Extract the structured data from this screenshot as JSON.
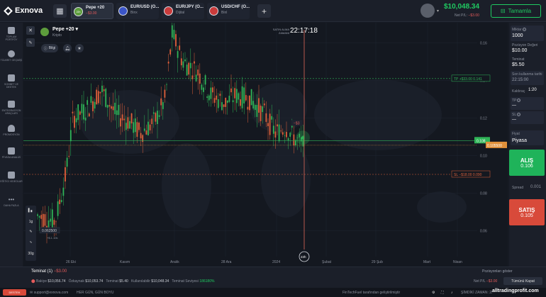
{
  "app": {
    "logo_text": "Exnova"
  },
  "tabs": [
    {
      "name": "Pepe +20",
      "sub": "−$3.00",
      "badge": "22h",
      "active": true
    },
    {
      "name": "EUR/USD (O...",
      "sub": "Binx",
      "active": false
    },
    {
      "name": "EUR/JPY (O...",
      "sub": "Dijital",
      "active": false
    },
    {
      "name": "USD/CHF (O...",
      "sub": "Binl",
      "active": false
    }
  ],
  "account": {
    "balance": "$10,048.34",
    "net_pl_label": "Net P/L",
    "net_pl_value": "−$3.00",
    "topup_label": "Tamamla"
  },
  "sidebar": {
    "items": [
      {
        "label": "TOPLAM PORTFÖY",
        "icon": "portfolio-icon"
      },
      {
        "label": "TİCARET GEÇMİŞİ",
        "icon": "history-icon"
      },
      {
        "label": "SOHBET VE DESTEK",
        "icon": "chat-icon"
      },
      {
        "label": "ENTEGRASYON ARAÇLARI",
        "icon": "tools-icon"
      },
      {
        "label": "PROMOSYON",
        "icon": "flame-icon"
      },
      {
        "label": "PİYASA ANALİZİ",
        "icon": "analysis-icon"
      },
      {
        "label": "EĞİTİCİ VİDEOLAR",
        "icon": "video-icon"
      },
      {
        "label": "DAHA FAZLA",
        "icon": "more-icon"
      }
    ]
  },
  "asset": {
    "name": "Pepe +20",
    "category": "Kripto",
    "info_label": "Bilgi"
  },
  "chart_overlay": {
    "buy_time_label": "SATIN ALMA ZAMANI",
    "buy_time": "22:17:18",
    "expiry_badge": "22h",
    "trade_marker": "−$3"
  },
  "chart_data": {
    "type": "candlestick",
    "y_ticks": [
      "0.16",
      "0.14",
      "0.12",
      "0.10",
      "0.08",
      "0.06"
    ],
    "x_ticks": [
      "26 Eki",
      "Kasım",
      "Aralık",
      "28 Ara",
      "2024",
      "Şubat",
      "29 Şub",
      "Mart",
      "Nisan"
    ],
    "high_label": "0.174500",
    "low_label": "0.062500",
    "current_price": "0.108",
    "open_price": "0.105500",
    "tp_line": {
      "label": "TP",
      "amount": "+$33.00",
      "price": "0.141"
    },
    "sl_line": {
      "label": "SL",
      "amount": "−$18.00",
      "price": "0.090"
    },
    "low_note": "+$.1.10k",
    "ylim": [
      0.05,
      0.17
    ]
  },
  "left_tools": {
    "timeframe": "1g",
    "period": "30g"
  },
  "right_panel": {
    "amount_label": "Miktar",
    "amount_value": "1000",
    "position_value_label": "Pozisyon Değeri",
    "position_value": "$10.00",
    "margin_label": "Teminat",
    "margin_value": "$5.50",
    "expiry_label": "Son kullanma tarihi",
    "expiry_value": "22:15:00",
    "leverage_label": "Kaldıraç",
    "leverage_value": "1:20",
    "tp_label": "TP",
    "tp_value": "—",
    "sl_label": "SL",
    "sl_value": "—",
    "price_label": "Fiyat",
    "price_value": "Piyasa",
    "buy_label": "ALIŞ",
    "buy_price": "0.106",
    "spread_label": "Spread",
    "spread_value": "0.001",
    "sell_label": "SATIŞ",
    "sell_price": "0.105"
  },
  "bottom": {
    "positions_label": "Teminat (1)",
    "positions_value": "−$3.00",
    "show_positions": "Pozisyonları göster",
    "balance_label": "Bakiye",
    "balance": "$10,056.74",
    "equity_label": "Özkaynak",
    "equity": "$10,053.74",
    "margin_label": "Teminat",
    "margin": "$5.40",
    "available_label": "Kullanılabilir",
    "available": "$10,048.34",
    "margin_level_label": "Teminat Seviyesi",
    "margin_level": "186180%",
    "netpl_label": "Net P/L",
    "netpl": "−$3.00",
    "close_all": "Tümünü Kapat"
  },
  "footer": {
    "support_btn": "DESTEK",
    "email": "support@exnova.com",
    "slogan": "HER GÜN, GÜN BOYU",
    "fintech": "FinTechFuel tarafından geliştirilmiştir",
    "time": "ŞİMDİKİ ZAMAN: 29 OCAK 22:15:52",
    "watermark": "alltradingprofit.com"
  }
}
